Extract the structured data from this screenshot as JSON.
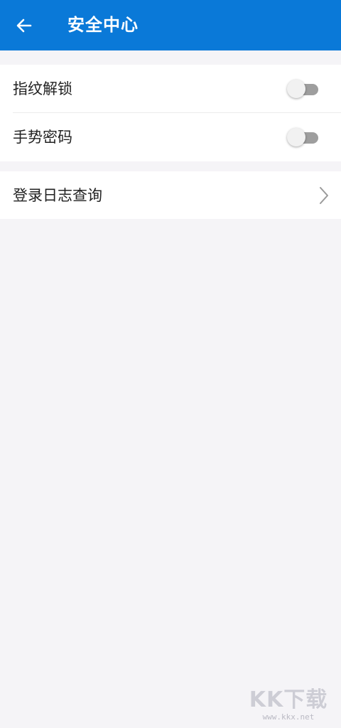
{
  "header": {
    "title": "安全中心",
    "back_icon": "arrow-left-icon",
    "background_color": "#0a79d8"
  },
  "settings": {
    "fingerprint_unlock": {
      "label": "指纹解锁",
      "enabled": false
    },
    "gesture_password": {
      "label": "手势密码",
      "enabled": false
    },
    "login_log": {
      "label": "登录日志查询",
      "icon": "chevron-right-icon"
    }
  },
  "watermark": {
    "logo": "KK下载",
    "url": "www.kkx.net"
  }
}
